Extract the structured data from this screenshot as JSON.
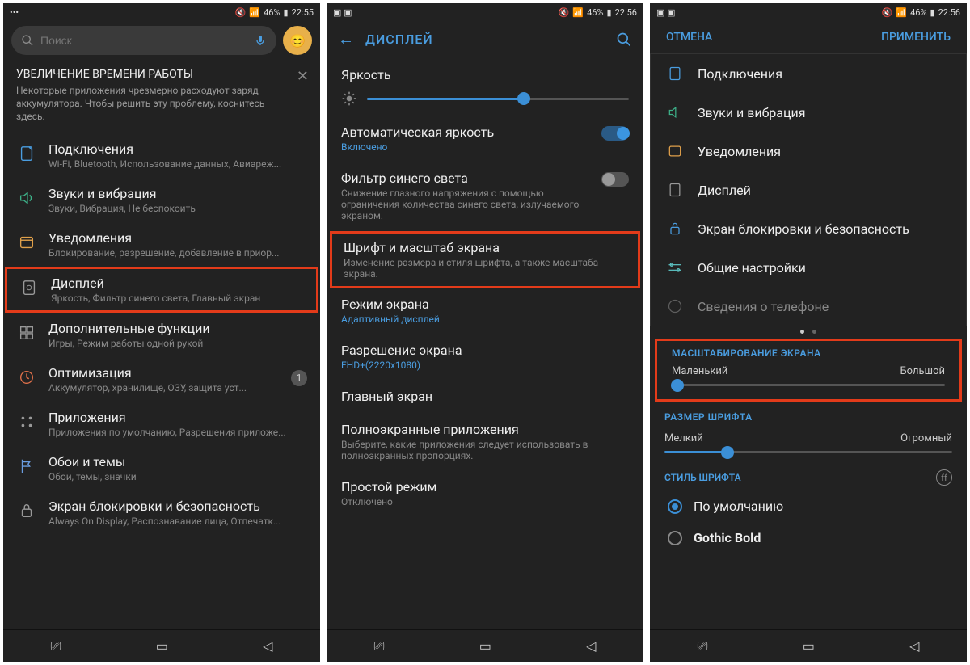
{
  "status": {
    "battery": "46%",
    "time1": "22:55",
    "time2": "22:56"
  },
  "screen1": {
    "search_placeholder": "Поиск",
    "banner_title": "УВЕЛИЧЕНИЕ ВРЕМЕНИ РАБОТЫ",
    "banner_desc": "Некоторые приложения чрезмерно расходуют заряд аккумулятора. Чтобы решить эту проблему, коснитесь здесь.",
    "items": [
      {
        "title": "Подключения",
        "sub": "Wi-Fi, Bluetooth, Использование данных, Авиареж..."
      },
      {
        "title": "Звуки и вибрация",
        "sub": "Звуки, Вибрация, Не беспокоить"
      },
      {
        "title": "Уведомления",
        "sub": "Блокирование, разрешение, добавление в приор..."
      },
      {
        "title": "Дисплей",
        "sub": "Яркость, Фильтр синего света, Главный экран"
      },
      {
        "title": "Дополнительные функции",
        "sub": "Игры, Режим работы одной рукой"
      },
      {
        "title": "Оптимизация",
        "sub": "Аккумулятор, хранилище, ОЗУ, защита уст...",
        "badge": "1"
      },
      {
        "title": "Приложения",
        "sub": "Приложения по умолчанию, Разрешения приложе..."
      },
      {
        "title": "Обои и темы",
        "sub": "Обои, темы, значки"
      },
      {
        "title": "Экран блокировки и безопасность",
        "sub": "Always On Display, Распознавание лица, Отпечатк..."
      }
    ]
  },
  "screen2": {
    "header": "ДИСПЛЕЙ",
    "brightness": "Яркость",
    "auto_bright": {
      "title": "Автоматическая яркость",
      "sub": "Включено"
    },
    "blue_filter": {
      "title": "Фильтр синего света",
      "sub": "Снижение глазного напряжения с помощью ограничения количества синего света, излучаемого экраном."
    },
    "font_scale": {
      "title": "Шрифт и масштаб экрана",
      "sub": "Изменение размера и стиля шрифта, а также масштаба экрана."
    },
    "screen_mode": {
      "title": "Режим экрана",
      "sub": "Адаптивный дисплей"
    },
    "resolution": {
      "title": "Разрешение экрана",
      "sub": "FHD+(2220x1080)"
    },
    "home": {
      "title": "Главный экран"
    },
    "fullscreen": {
      "title": "Полноэкранные приложения",
      "sub": "Выберите, какие приложения следует использовать в полноэкранных пропорциях."
    },
    "simple": {
      "title": "Простой режим",
      "sub": "Отключено"
    }
  },
  "screen3": {
    "cancel": "ОТМЕНА",
    "apply": "ПРИМЕНИТЬ",
    "cats": [
      "Подключения",
      "Звуки и вибрация",
      "Уведомления",
      "Дисплей",
      "Экран блокировки и безопасность",
      "Общие настройки",
      "Сведения о телефоне"
    ],
    "scale_head": "МАСШТАБИРОВАНИЕ ЭКРАНА",
    "scale_small": "Маленький",
    "scale_big": "Большой",
    "font_head": "РАЗМЕР ШРИФТА",
    "font_small": "Мелкий",
    "font_big": "Огромный",
    "style_head": "СТИЛЬ ШРИФТА",
    "style_default": "По умолчанию",
    "style_gothic": "Gothic Bold"
  }
}
